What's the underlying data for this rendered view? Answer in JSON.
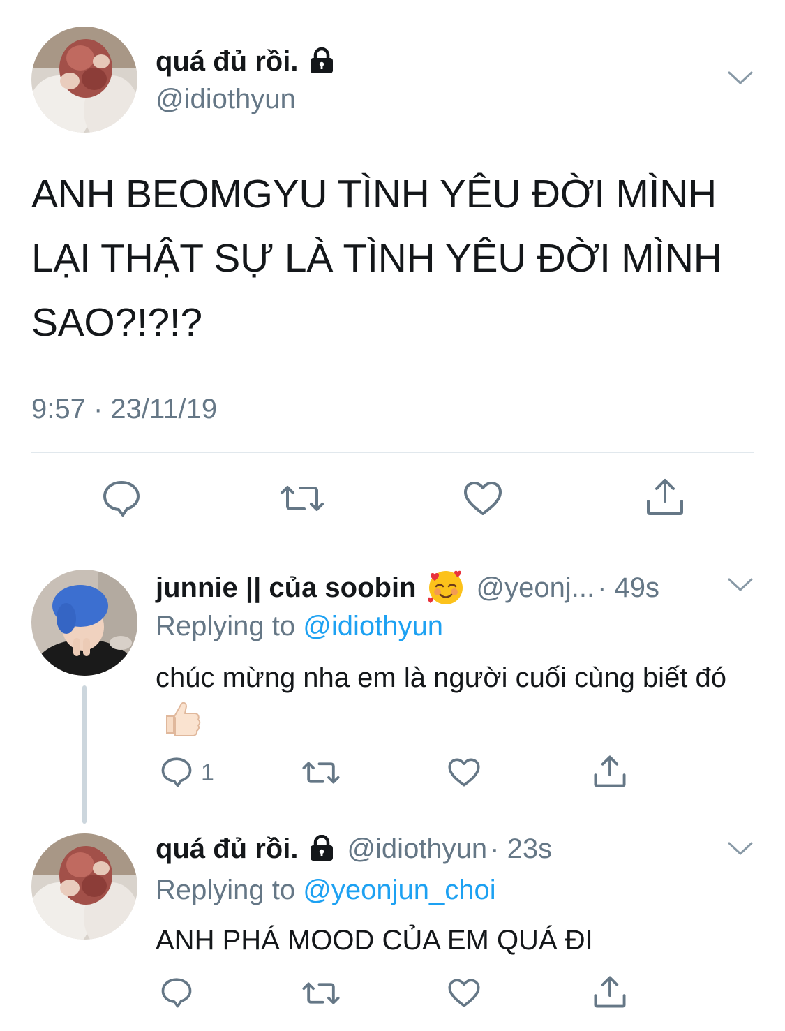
{
  "main_tweet": {
    "display_name": "quá đủ rồi.",
    "handle": "@idiothyun",
    "text": "ANH BEOMGYU TÌNH YÊU ĐỜI MÌNH LẠI THẬT SỰ LÀ TÌNH YÊU ĐỜI MÌNH SAO?!?!?",
    "timestamp": "9:57 · 23/11/19",
    "protected": true,
    "icons": [
      "lock-icon",
      "chevron-down-icon",
      "reply-icon",
      "retweet-icon",
      "like-icon",
      "share-icon"
    ]
  },
  "replies": [
    {
      "display_name": "junnie || của soobin",
      "emoji": "🥰",
      "handle_truncated": "@yeonj...",
      "time": "· 49s",
      "replying_label": "Replying to",
      "replying_to": "@idiothyun",
      "text": "chúc mừng nha em là người cuối cùng biết đó",
      "text_emoji": "👍🏻",
      "reply_count": "1"
    },
    {
      "display_name": "quá đủ rồi.",
      "handle": "@idiothyun",
      "time": "· 23s",
      "replying_label": "Replying to",
      "replying_to": "@yeonjun_choi",
      "text": "ANH PHÁ MOOD CỦA EM QUÁ ĐI",
      "protected": true
    }
  ],
  "colors": {
    "text": "#14171a",
    "secondary": "#657786",
    "link": "#1da1f2",
    "divider": "#e1e8ed",
    "thread_line": "#ccd6dd"
  }
}
